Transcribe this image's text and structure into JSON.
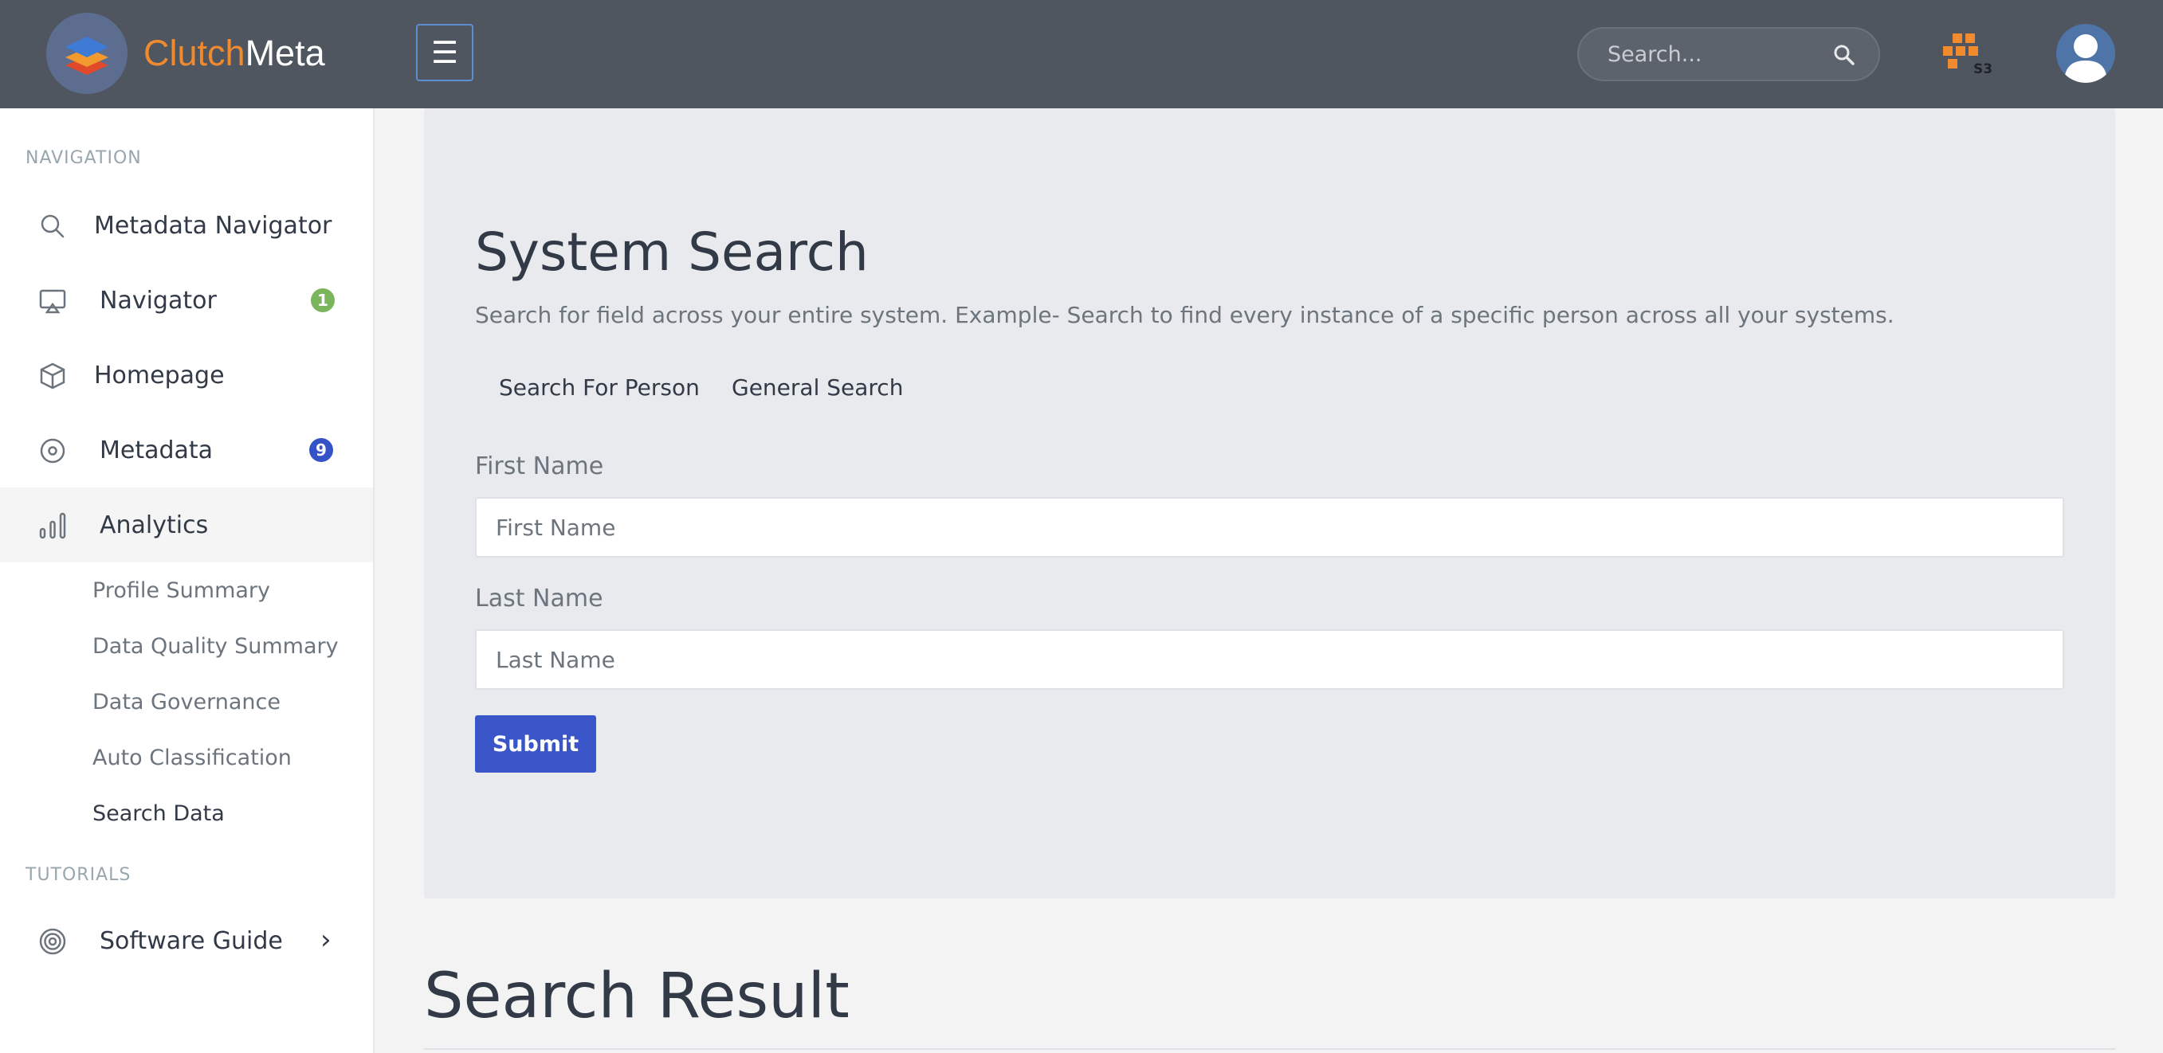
{
  "app": {
    "brand_part1": "Clutch",
    "brand_part2": "Meta",
    "menu_icon": "hamburger-icon",
    "search_placeholder": "Search...",
    "search_icon": "search-icon",
    "s3_label": "S3",
    "accent_color": "#3a55c8",
    "brand_color": "#f08a2e"
  },
  "sidebar": {
    "navigation_title": "NAVIGATION",
    "items": [
      {
        "label": "Metadata Navigator",
        "icon": "search-icon"
      },
      {
        "label": "Navigator",
        "icon": "monitor-icon",
        "badge": "1",
        "badge_color": "#7ab55c"
      },
      {
        "label": "Homepage",
        "icon": "cube-icon"
      },
      {
        "label": "Metadata",
        "icon": "disc-icon",
        "badge": "9",
        "badge_color": "#3552c6"
      },
      {
        "label": "Analytics",
        "icon": "bar-chart-icon"
      }
    ],
    "sub_items": [
      {
        "label": "Profile Summary"
      },
      {
        "label": "Data Quality Summary"
      },
      {
        "label": "Data Governance"
      },
      {
        "label": "Auto Classification"
      },
      {
        "label": "Search Data"
      }
    ],
    "tutorials_title": "TUTORIALS",
    "guide": {
      "label": "Software Guide",
      "icon": "target-icon"
    }
  },
  "main": {
    "title": "System Search",
    "description": "Search for field across your entire system. Example- Search to find every instance of a specific person across all your systems.",
    "tabs": [
      {
        "label": "Search For Person"
      },
      {
        "label": "General Search"
      }
    ],
    "first_name": {
      "label": "First Name",
      "placeholder": "First Name"
    },
    "last_name": {
      "label": "Last Name",
      "placeholder": "Last Name"
    },
    "submit_label": "Submit",
    "result_title": "Search Result"
  }
}
